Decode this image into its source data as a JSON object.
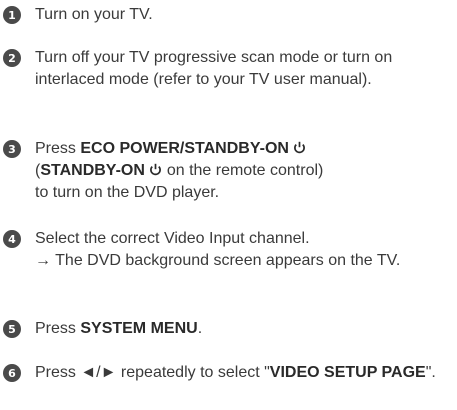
{
  "steps": [
    {
      "number": "1",
      "text": "Turn on your TV."
    },
    {
      "number": "2",
      "text": "Turn off your TV progressive scan mode or turn on interlaced mode (refer to your TV user manual)."
    },
    {
      "number": "3",
      "prefix": "Press ",
      "bold_a": "ECO POWER/STANDBY-ON",
      "paren_open": "(",
      "bold_b": "STANDBY-ON",
      "mid": " on the remote control)",
      "tail": "to turn on the DVD player.",
      "icon": "power-icon"
    },
    {
      "number": "4",
      "text": "Select the correct Video Input channel.",
      "result_arrow": "→",
      "result": "The DVD background screen appears on the TV."
    },
    {
      "number": "5",
      "prefix": "Press ",
      "bold": "SYSTEM MENU",
      "suffix": "."
    },
    {
      "number": "6",
      "prefix": "Press ",
      "keys": "◄/►",
      "middle": " repeatedly to select \"",
      "bold": "VIDEO SETUP PAGE",
      "suffix": "\"."
    }
  ]
}
